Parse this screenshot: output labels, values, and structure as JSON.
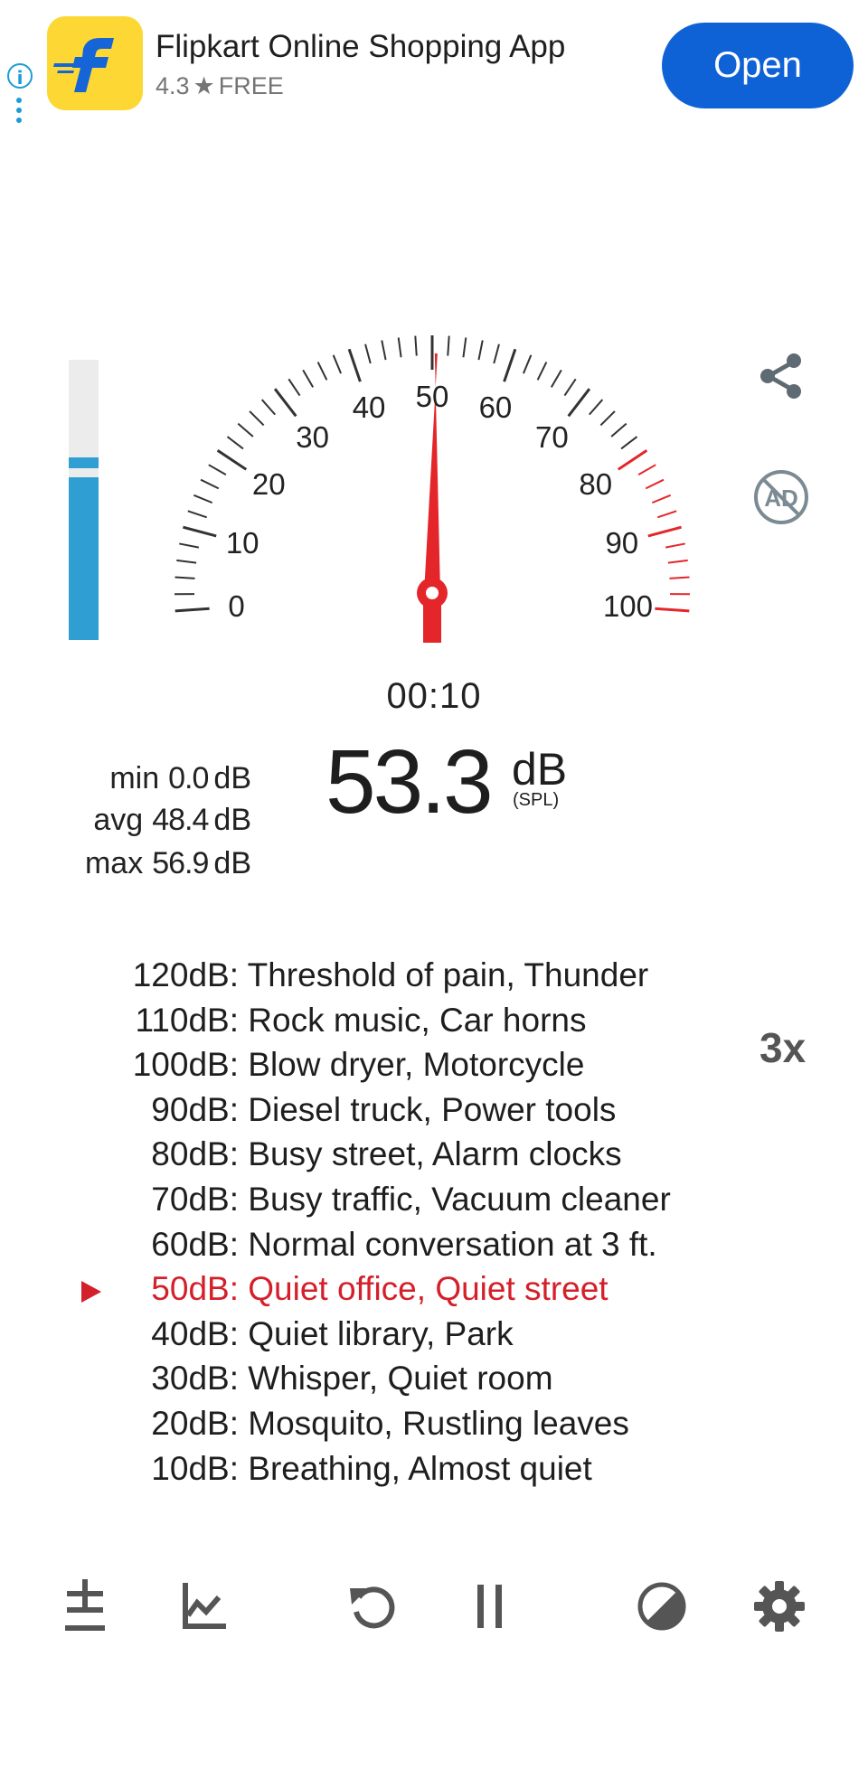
{
  "ad": {
    "app_name": "Flipkart Online Shopping App",
    "rating": "4.3",
    "star": "★",
    "price": "FREE",
    "open_label": "Open",
    "info_glyph": "i",
    "icon": "flipkart-logo"
  },
  "meter": {
    "level_fraction": 0.58,
    "peak_fraction": 0.56,
    "gauge_min": 0,
    "gauge_max": 100,
    "gauge_labels": [
      "0",
      "10",
      "20",
      "30",
      "40",
      "50",
      "60",
      "70",
      "80",
      "90",
      "100"
    ],
    "needle_value": 50.5,
    "red_zone_start": 80,
    "timer": "00:10",
    "current_value": "53.3",
    "unit": "dB",
    "sub_unit": "(SPL)",
    "stats": [
      {
        "label": "min",
        "value": "0.0",
        "unit": "dB"
      },
      {
        "label": "avg",
        "value": "48.4",
        "unit": "dB"
      },
      {
        "label": "max",
        "value": "56.9",
        "unit": "dB"
      }
    ]
  },
  "reference": {
    "speed": "3x",
    "active_index": 7,
    "rows": [
      {
        "db": "120dB:",
        "desc": "Threshold of pain, Thunder"
      },
      {
        "db": "110dB:",
        "desc": "Rock music, Car horns"
      },
      {
        "db": "100dB:",
        "desc": "Blow dryer, Motorcycle"
      },
      {
        "db": "90dB:",
        "desc": "Diesel truck, Power tools"
      },
      {
        "db": "80dB:",
        "desc": "Busy street, Alarm clocks"
      },
      {
        "db": "70dB:",
        "desc": "Busy traffic, Vacuum cleaner"
      },
      {
        "db": "60dB:",
        "desc": "Normal conversation at 3 ft."
      },
      {
        "db": "50dB:",
        "desc": "Quiet office, Quiet street"
      },
      {
        "db": "40dB:",
        "desc": "Quiet library, Park"
      },
      {
        "db": "30dB:",
        "desc": "Whisper, Quiet room"
      },
      {
        "db": "20dB:",
        "desc": "Mosquito, Rustling leaves"
      },
      {
        "db": "10dB:",
        "desc": "Breathing, Almost quiet"
      }
    ]
  },
  "toolbar": {
    "icons": [
      "plus-minus-icon",
      "chart-icon",
      "reset-icon",
      "pause-icon",
      "theme-icon",
      "settings-icon"
    ]
  },
  "colors": {
    "accent_blue": "#2f9fd3",
    "needle_red": "#e4262b",
    "ad_button": "#0f62d6",
    "active_row": "#d4202a",
    "icon_gray": "#555555"
  }
}
